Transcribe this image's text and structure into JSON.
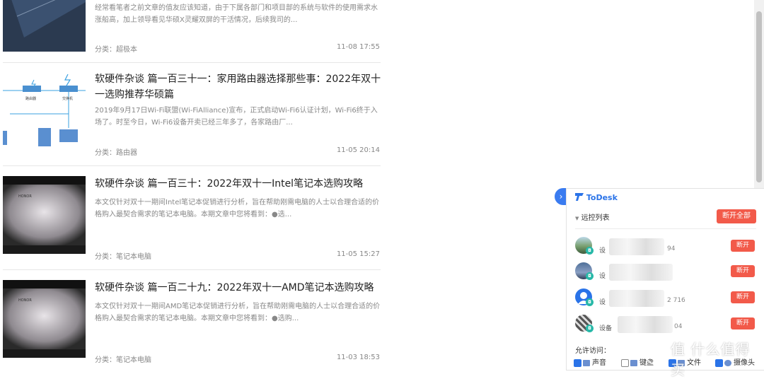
{
  "articles": [
    {
      "title": "",
      "summary": "经常看笔者之前文章的值友应该知道，由于下属各部门和项目部的系统与软件的使用需求水涨船高，加上领导看见华硕X灵耀双屏的干活情况，后续我司的...",
      "category": "分类：超极本",
      "date": "11-08 17:55"
    },
    {
      "title": "软硬件杂谈 篇一百三十一：家用路由器选择那些事：2022年双十一选购推荐华硕篇",
      "summary": "2019年9月17日Wi-Fi联盟(Wi-FiAlliance)宣布，正式启动Wi-Fi6认证计划，Wi-Fi6终于入场了。时至今日，Wi-Fi6设备开卖已经三年多了，各家路由厂...",
      "category": "分类：路由器",
      "date": "11-05 20:14"
    },
    {
      "title": "软硬件杂谈 篇一百三十：2022年双十一Intel笔记本选购攻略",
      "summary": "本文仅针对双十一期间Intel笔记本促销进行分析，旨在帮助刚需电脑的人士以合理合适的价格购入最契合需求的笔记本电脑。本期文章中您将看到：●选...",
      "category": "分类：笔记本电脑",
      "date": "11-05 15:27"
    },
    {
      "title": "软硬件杂谈 篇一百二十九：2022年双十一AMD笔记本选购攻略",
      "summary": "本文仅针对双十一期间AMD笔记本促销进行分析，旨在帮助刚需电脑的人士以合理合适的价格购入最契合需求的笔记本电脑。本期文章中您将看到：●选购...",
      "category": "分类：笔记本电脑",
      "date": "11-03 18:53"
    }
  ],
  "thumb_labels": {
    "router1": "路由器",
    "router2": "交换机",
    "honor": "HONOR"
  },
  "todesk": {
    "brand": "ToDesk",
    "list_header": "远控列表",
    "disconnect_all": "断开全部",
    "devices": [
      {
        "name": "设",
        "id_suffix": "94",
        "avatar": "landscape",
        "button": "断开"
      },
      {
        "name": "设",
        "id_suffix": "",
        "avatar": "photo",
        "button": "断开"
      },
      {
        "name": "设",
        "id_suffix": "2 716",
        "avatar": "person",
        "button": "断开"
      },
      {
        "name": "设备",
        "id_suffix": "04",
        "avatar": "pixel",
        "button": "断开"
      }
    ],
    "allow_access_label": "允许访问：",
    "permissions": [
      {
        "label": "声音",
        "checked": true
      },
      {
        "label": "键盘",
        "checked": false
      },
      {
        "label": "文件",
        "checked": true
      },
      {
        "label": "摄像头",
        "checked": true
      }
    ]
  },
  "watermark": "值 什么值得买",
  "colors": {
    "accent_blue": "#2a73e8",
    "danger_red": "#f25a4a",
    "muted_text": "#888888"
  }
}
